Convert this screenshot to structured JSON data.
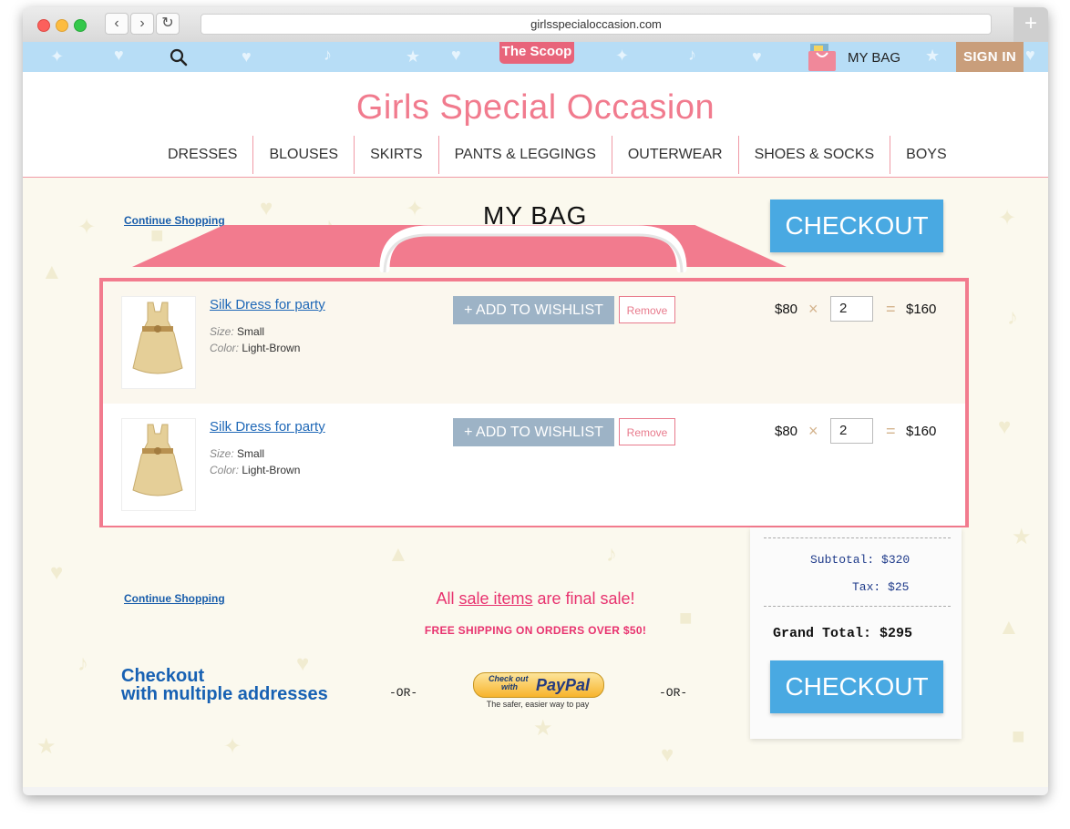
{
  "browser": {
    "url": "girlsspecialoccasion.com",
    "back_icon": "‹",
    "forward_icon": "›",
    "reload_icon": "↻",
    "newtab_icon": "+"
  },
  "topbar": {
    "scoop_label": "The Scoop",
    "mybag_label": "MY BAG",
    "signin_label": "SIGN IN"
  },
  "site": {
    "logo": "Girls Special Occasion"
  },
  "nav": {
    "items": [
      "DRESSES",
      "BLOUSES",
      "SKIRTS",
      "PANTS & LEGGINGS",
      "OUTERWEAR",
      "SHOES & SOCKS",
      "BOYS"
    ]
  },
  "bag": {
    "continue_top": "Continue Shopping",
    "title": "MY BAG",
    "checkout_top": "CHECKOUT",
    "items": [
      {
        "name": "Silk Dress for party",
        "size_label": "Size:",
        "size": "Small",
        "color_label": "Color:",
        "color": "Light-Brown",
        "wishlist": "+ ADD TO WISHLIST",
        "remove": "Remove",
        "price": "$80",
        "qty": "2",
        "total": "$160"
      },
      {
        "name": "Silk Dress for party",
        "size_label": "Size:",
        "size": "Small",
        "color_label": "Color:",
        "color": "Light-Brown",
        "wishlist": "+ ADD TO WISHLIST",
        "remove": "Remove",
        "price": "$80",
        "qty": "2",
        "total": "$160"
      }
    ],
    "times_sign": "×",
    "equals_sign": "="
  },
  "footer": {
    "continue_bottom": "Continue Shopping",
    "sale_prefix": "All ",
    "sale_link": "sale items",
    "sale_suffix": " are final sale!",
    "free_shipping": "FREE SHIPPING ON ORDERS OVER $50!",
    "multi_line1": "Checkout",
    "multi_line2": "with multiple addresses",
    "or_label": "-OR-",
    "paypal_check": "Check out",
    "paypal_with": "with",
    "paypal_brand": "PayPal",
    "paypal_tagline": "The safer, easier way to pay"
  },
  "receipt": {
    "subtotal_label": "Subtotal:",
    "subtotal": "$320",
    "tax_label": "Tax:",
    "tax": "$25",
    "grand_label": "Grand Total:",
    "grand_total": "$295",
    "checkout_bottom": "CHECKOUT"
  },
  "colors": {
    "brand_pink": "#f27b8e",
    "checkout_blue": "#49a9e2",
    "sale_pink": "#e8336f",
    "link_blue": "#1a5eab"
  }
}
